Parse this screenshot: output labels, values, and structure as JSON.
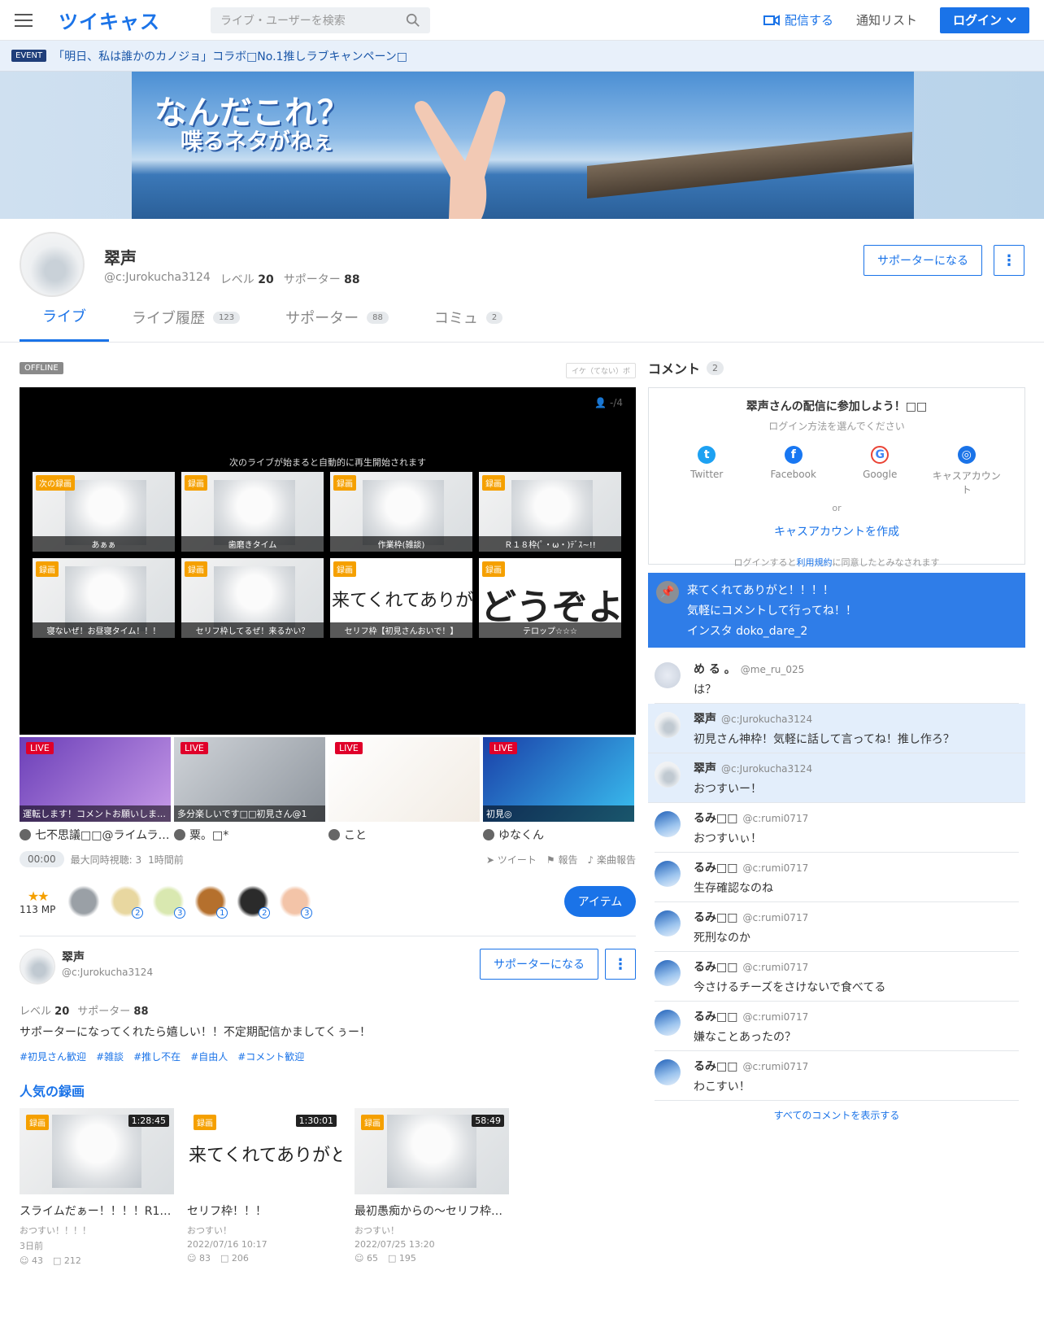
{
  "header": {
    "logo": "ツイキャス",
    "search_placeholder": "ライブ・ユーザーを検索",
    "broadcast": "配信する",
    "notifications": "通知リスト",
    "login": "ログイン"
  },
  "event": {
    "tag": "EVENT",
    "text": "「明日、私は誰かのカノジョ」コラボ□No.1推しラブキャンペーン□"
  },
  "banner": {
    "line1": "なんだこれ？",
    "line2": "喋るネタがねぇ"
  },
  "profile": {
    "name": "翠声",
    "id": "@c:Jurokucha3124",
    "level_label": "レベル",
    "level": "20",
    "supporter_label": "サポーター",
    "supporters": "88",
    "supporter_button": "サポーターになる",
    "more": "⋮"
  },
  "tabs": [
    {
      "label": "ライブ",
      "count": ""
    },
    {
      "label": "ライブ履歴",
      "count": "123"
    },
    {
      "label": "サポーター",
      "count": "88"
    },
    {
      "label": "コミュ",
      "count": "2"
    }
  ],
  "player": {
    "status": "OFFLINE",
    "ticker": "イケ（てない）ボ",
    "viewers": "-/4",
    "autoplay_msg": "次のライブが始まると自動的に再生開始されます",
    "recordings": [
      {
        "badge": "次の録画",
        "caption": "あぁぁ",
        "type": "img",
        "text": ""
      },
      {
        "badge": "録画",
        "caption": "歯磨きタイム",
        "type": "img",
        "text": ""
      },
      {
        "badge": "録画",
        "caption": "作業枠(雑談)",
        "type": "img",
        "text": ""
      },
      {
        "badge": "録画",
        "caption": "Ｒ１８枠(ﾟ・ω・)ﾃﾞｽ~!!",
        "type": "img",
        "text": ""
      },
      {
        "badge": "録画",
        "caption": "寝ないぜ！お昼寝タイム！！！",
        "type": "img",
        "text": ""
      },
      {
        "badge": "録画",
        "caption": "セリフ枠してるぜ！来るかい？",
        "type": "img",
        "text": ""
      },
      {
        "badge": "録画",
        "caption": "セリフ枠【初見さんおいで！】",
        "type": "txt",
        "text": "来てくれてありがと"
      },
      {
        "badge": "録画",
        "caption": "テロップ☆☆☆",
        "type": "huge",
        "text": "どうぞよろ"
      }
    ]
  },
  "live_now": [
    {
      "tag": "LIVE",
      "caption": "運転します！コメントお願いしま…",
      "name": "七不思議□□@ライムラ…",
      "bg": "purple"
    },
    {
      "tag": "LIVE",
      "caption": "多分楽しいです□□初見さん@1",
      "name": "粟。□*",
      "bg": "gray"
    },
    {
      "tag": "LIVE",
      "caption": "",
      "name": "こと",
      "bg": "white"
    },
    {
      "tag": "LIVE",
      "caption": "初見◎",
      "name": "ゆなくん",
      "bg": "blue"
    }
  ],
  "stats": {
    "time": "00:00",
    "max_viewers": "最大同時視聴: 3",
    "ago": "1時間前",
    "tweet": "ツイート",
    "report": "報告",
    "music_report": "楽曲報告"
  },
  "items": {
    "mp": "113 MP",
    "stars": "★★",
    "button": "アイテム",
    "list": [
      {
        "name": "coin-icon",
        "count": ""
      },
      {
        "name": "drink-icon",
        "count": "2"
      },
      {
        "name": "tea-icon",
        "count": "3"
      },
      {
        "name": "bear-icon",
        "count": "1"
      },
      {
        "name": "girl-icon",
        "count": "2"
      },
      {
        "name": "clap-icon",
        "count": "3"
      }
    ]
  },
  "owner": {
    "name": "翠声",
    "id": "@c:Jurokucha3124",
    "supporter_button": "サポーターになる",
    "more": "⋮",
    "level_label": "レベル",
    "level": "20",
    "supporter_label": "サポーター",
    "supporters": "88",
    "bio": "サポーターになってくれたら嬉しい！！不定期配信かましてくぅー！",
    "tags": [
      "#初見さん歓迎",
      "#雑談",
      "#推し不在",
      "#自由人",
      "#コメント歓迎"
    ]
  },
  "popular": {
    "title": "人気の録画",
    "videos": [
      {
        "badge": "録画",
        "duration": "1:28:45",
        "title": "スライムだぁー！！！！R1…",
        "sub": "おつすい！！！！",
        "date": "3日前",
        "views": "43",
        "comments": "212",
        "type": "img",
        "text": ""
      },
      {
        "badge": "録画",
        "duration": "1:30:01",
        "title": "セリフ枠！！！",
        "sub": "おつすい！",
        "date": "2022/07/16 10:17",
        "views": "83",
        "comments": "206",
        "type": "txt",
        "text": "来てくれてありがと"
      },
      {
        "badge": "録画",
        "duration": "58:49",
        "title": "最初愚痴からの〜セリフ枠…",
        "sub": "おつすい！",
        "date": "2022/07/25 13:20",
        "views": "65",
        "comments": "195",
        "type": "img",
        "text": ""
      }
    ]
  },
  "comments": {
    "title": "コメント",
    "count": "2",
    "login_box": {
      "title": "翠声さんの配信に参加しよう！□□",
      "subtitle": "ログイン方法を選んでください",
      "options": [
        "Twitter",
        "Facebook",
        "Google",
        "キャスアカウント"
      ],
      "or": "or",
      "create": "キャスアカウントを作成",
      "agree_pre": "ログインすると",
      "agree_link": "利用規約",
      "agree_post": "に同意したとみなされます"
    },
    "pinned": [
      "来てくれてありがと！！！！",
      "気軽にコメントして行ってね！！",
      "インスタ doko_dare_2"
    ],
    "list": [
      {
        "name": "め る 。",
        "id": "@me_ru_025",
        "text": "は？",
        "highlight": false
      },
      {
        "name": "翠声",
        "id": "@c:Jurokucha3124",
        "text": "初見さん神枠！気軽に話して言ってね！推し作ろ？",
        "highlight": true
      },
      {
        "name": "翠声",
        "id": "@c:Jurokucha3124",
        "text": "おつすいー！",
        "highlight": true
      },
      {
        "name": "るみ□□",
        "id": "@c:rumi0717",
        "text": "おつすいぃ！",
        "highlight": false
      },
      {
        "name": "るみ□□",
        "id": "@c:rumi0717",
        "text": "生存確認なのね",
        "highlight": false
      },
      {
        "name": "るみ□□",
        "id": "@c:rumi0717",
        "text": "死刑なのか",
        "highlight": false
      },
      {
        "name": "るみ□□",
        "id": "@c:rumi0717",
        "text": "今さけるチーズをさけないで食べてる",
        "highlight": false
      },
      {
        "name": "るみ□□",
        "id": "@c:rumi0717",
        "text": "嫌なことあったの？",
        "highlight": false
      },
      {
        "name": "るみ□□",
        "id": "@c:rumi0717",
        "text": "わこすい！",
        "highlight": false
      }
    ],
    "show_all": "すべてのコメントを表示する"
  },
  "colors": {
    "accent": "#1a73e8",
    "live": "#e0002a",
    "badge": "#f5a000",
    "pinned": "#2f7de8"
  }
}
